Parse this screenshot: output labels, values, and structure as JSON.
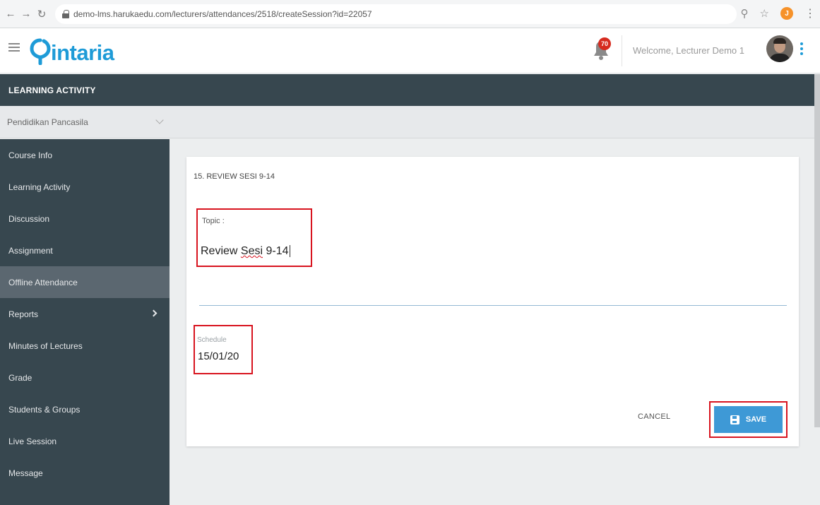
{
  "browser": {
    "url": "demo-lms.harukaedu.com/lecturers/attendances/2518/createSession?id=22057",
    "extension_badge": "J"
  },
  "header": {
    "logo_text": "intaria",
    "notification_count": "70",
    "welcome": "Welcome, Lecturer Demo 1"
  },
  "section_bar": {
    "title": "LEARNING ACTIVITY"
  },
  "course_selector": {
    "value": "Pendidikan Pancasila"
  },
  "sidebar": {
    "items": [
      {
        "label": "Course Info"
      },
      {
        "label": "Learning Activity"
      },
      {
        "label": "Discussion"
      },
      {
        "label": "Assignment"
      },
      {
        "label": "Offline Attendance"
      },
      {
        "label": "Reports"
      },
      {
        "label": "Minutes of Lectures"
      },
      {
        "label": "Grade"
      },
      {
        "label": "Students & Groups"
      },
      {
        "label": "Live Session"
      },
      {
        "label": "Message"
      }
    ]
  },
  "form": {
    "session_title": "15. REVIEW SESI 9-14",
    "topic_label": "Topic :",
    "topic_value_prefix": "Review ",
    "topic_value_misspelled": "Sesi",
    "topic_value_suffix": " 9-14",
    "schedule_label": "Schedule",
    "schedule_value": "15/01/20",
    "cancel_label": "CANCEL",
    "save_label": "SAVE"
  },
  "colors": {
    "sidebar_bg": "#37474f",
    "active_item_bg": "#5b6770",
    "brand_blue": "#1e9bd7",
    "save_button": "#3e99d6",
    "highlight_red": "#d8141f"
  }
}
